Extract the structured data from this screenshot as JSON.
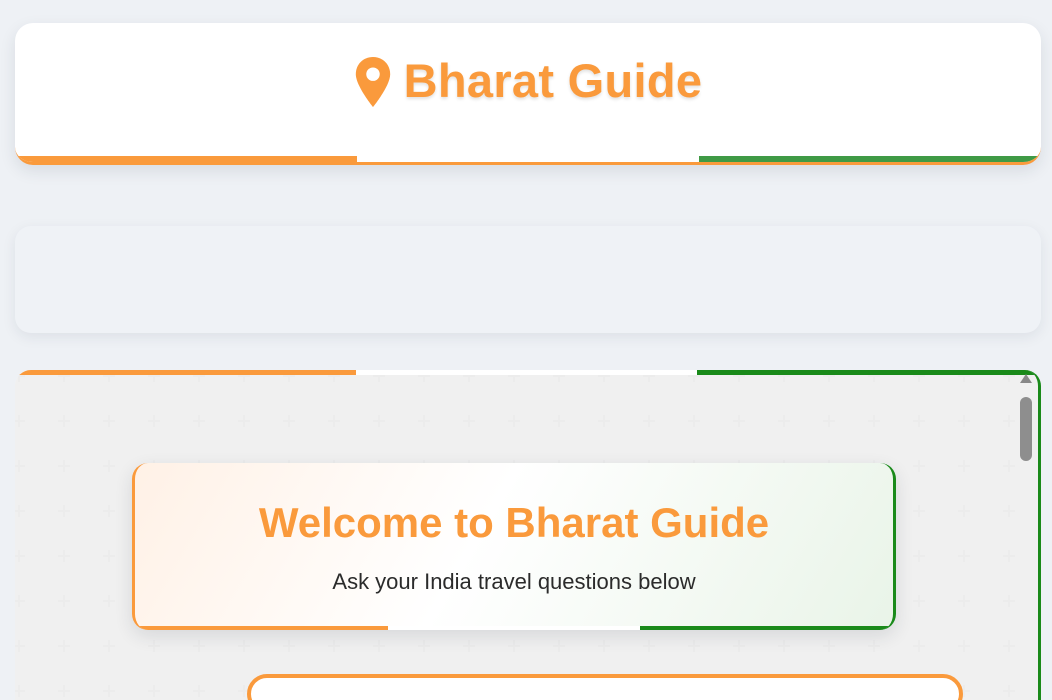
{
  "header": {
    "title": "Bharat Guide",
    "icon": "map-pin-icon"
  },
  "welcome": {
    "title": "Welcome to Bharat Guide",
    "subtitle": "Ask your India travel questions below"
  },
  "colors": {
    "saffron": "#fa9a3c",
    "white": "#ffffff",
    "green": "#1a8a1a",
    "background": "#eef1f5"
  }
}
